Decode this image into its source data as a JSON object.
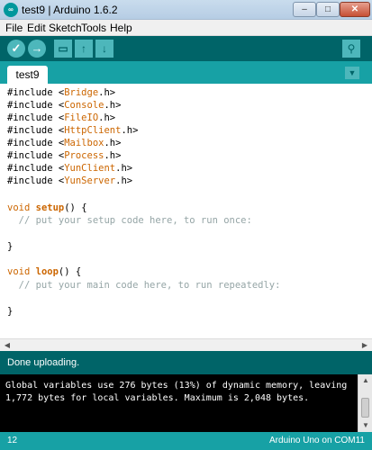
{
  "window": {
    "title": "test9 | Arduino 1.6.2",
    "app_icon": "arduino-logo-icon",
    "controls": {
      "minimize": "–",
      "maximize": "□",
      "close": "✕"
    }
  },
  "menu": [
    "File",
    "Edit",
    "Sketch",
    "Tools",
    "Help"
  ],
  "toolbar": {
    "verify": "✓",
    "upload": "→",
    "new": "▭",
    "open": "↑",
    "save": "↓",
    "serial_monitor": "⚲",
    "icons": [
      "verify-icon",
      "upload-icon",
      "new-icon",
      "open-icon",
      "save-icon",
      "serial-monitor-icon"
    ]
  },
  "tabs": [
    {
      "label": "test9"
    }
  ],
  "tab_menu": "▼",
  "code": {
    "includes": [
      {
        "pre": "#include <",
        "lib": "Bridge",
        "post": ".h>"
      },
      {
        "pre": "#include <",
        "lib": "Console",
        "post": ".h>"
      },
      {
        "pre": "#include <",
        "lib": "FileIO",
        "post": ".h>"
      },
      {
        "pre": "#include <",
        "lib": "HttpClient",
        "post": ".h>"
      },
      {
        "pre": "#include <",
        "lib": "Mailbox",
        "post": ".h>"
      },
      {
        "pre": "#include <",
        "lib": "Process",
        "post": ".h>"
      },
      {
        "pre": "#include <",
        "lib": "YunClient",
        "post": ".h>"
      },
      {
        "pre": "#include <",
        "lib": "YunServer",
        "post": ".h>"
      }
    ],
    "setup": {
      "type": "void",
      "name": "setup",
      "sig": "() {",
      "comment": "  // put your setup code here, to run once:",
      "close": "}"
    },
    "loop": {
      "type": "void",
      "name": "loop",
      "sig": "() {",
      "comment": "  // put your main code here, to run repeatedly:",
      "close": "}"
    }
  },
  "status": {
    "message": "Done uploading."
  },
  "console": {
    "lines": [
      "Global variables use 276 bytes (13%) of dynamic memory, leaving",
      "1,772 bytes for local variables. Maximum is 2,048 bytes."
    ]
  },
  "footer": {
    "line": "12",
    "board": "Arduino Uno on COM11"
  },
  "colors": {
    "toolbar": "#006468",
    "tabstrip": "#17a1a5",
    "keyword": "#cc6600",
    "comment": "#95a5a6"
  }
}
